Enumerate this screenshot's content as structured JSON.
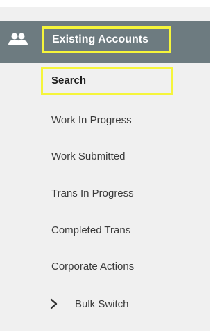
{
  "sidebar": {
    "header": {
      "icon": "people-icon",
      "label": "Existing Accounts"
    },
    "items": [
      {
        "label": "Search",
        "selected": true
      },
      {
        "label": "Work In Progress"
      },
      {
        "label": "Work Submitted"
      },
      {
        "label": "Trans In Progress"
      },
      {
        "label": "Completed Trans"
      },
      {
        "label": "Corporate Actions"
      }
    ],
    "expandable_item": {
      "icon": "chevron-right-icon",
      "label": "Bulk Switch"
    }
  },
  "colors": {
    "header_bg": "#6d7b80",
    "panel_bg": "#f0f0f0",
    "highlight_border": "#f5f53b"
  }
}
